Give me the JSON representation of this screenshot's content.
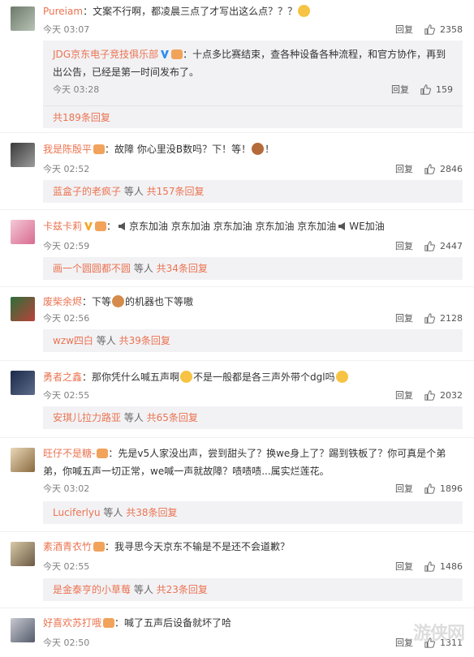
{
  "ui": {
    "reply_label": "回复",
    "time_prefix": "今天"
  },
  "comments": [
    {
      "name": "Pureiam",
      "text": "：文案不行啊，都凌晨三点了才写出这么点？？？",
      "time": "03:07",
      "likes": "2358",
      "nested": {
        "name": "JDG京东电子竞技俱乐部",
        "text": "：十点多比赛结束，查各种设备各种流程，和官方协作，再到出公告，已经是第一时间发布了。",
        "time": "03:28",
        "likes": "159"
      },
      "more": "共189条回复"
    },
    {
      "name": "我是陈殷平",
      "text": "：故障 你心里没B数吗？下！等！",
      "time": "02:52",
      "likes": "2846",
      "sub_link": "蓝盒子的老疯子",
      "sub_mid": " 等人 ",
      "more": "共157条回复"
    },
    {
      "name": "卡兹卡莉",
      "text_a": "：",
      "text_b": "京东加油 京东加油 京东加油 京东加油 京东加油",
      "text_c": "WE加油",
      "time": "02:59",
      "likes": "2447",
      "sub_link": "画一个圆圆都不圆",
      "sub_mid": " 等人 ",
      "more": "共34条回复"
    },
    {
      "name": "废柴余烬",
      "text_a": "：下等",
      "text_b": "的机器也下等嗷",
      "time": "02:56",
      "likes": "2128",
      "sub_link": "wzw四白",
      "sub_mid": " 等人 ",
      "more": "共39条回复"
    },
    {
      "name": "勇者之鑫",
      "text_a": "：那你凭什么喊五声啊",
      "text_b": "不是一般都是各三声外带个dgl吗",
      "time": "02:55",
      "likes": "2032",
      "sub_link": "安琪儿拉力路亚",
      "sub_mid": " 等人 ",
      "more": "共65条回复"
    },
    {
      "name": "旺仔不是糖-",
      "text": "：先是v5人家没出声，尝到甜头了？换we身上了？踢到铁板了？你可真是个弟弟，你喊五声一切正常，we喊一声就故障？啧啧啧...属实烂莲花。",
      "time": "03:02",
      "likes": "1896",
      "sub_link": "Luciferlyu",
      "sub_mid": " 等人 ",
      "more": "共38条回复"
    },
    {
      "name": "素酒青衣竹",
      "text": "：我寻思今天京东不输是不是还不会道歉？",
      "time": "02:55",
      "likes": "1486",
      "sub_link": "是金泰亨的小草莓",
      "sub_mid": " 等人 ",
      "more": "共23条回复"
    },
    {
      "name": "好喜欢苏打哦",
      "text": "：喊了五声后设备就坏了哈",
      "time": "02:50",
      "likes": "1311"
    }
  ],
  "watermark": "游侠网",
  "colors": {
    "name": "#eb7350",
    "sub_bg": "#f2f2f5"
  }
}
